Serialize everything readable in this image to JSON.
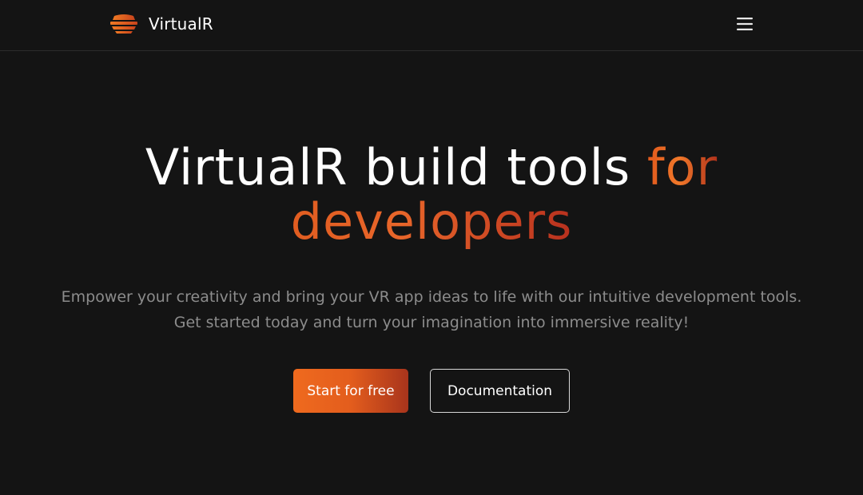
{
  "header": {
    "brand_name": "VirtualR",
    "logo_icon": "virtualr-logo-icon",
    "menu_icon": "hamburger-menu-icon"
  },
  "hero": {
    "title_main": "VirtualR build tools",
    "title_accent": "for",
    "title_line2": "developers",
    "subtitle_line1": "Empower your creativity and bring your VR app ideas to life with our intuitive development tools.",
    "subtitle_line2": "Get started today and turn your imagination into immersive reality!"
  },
  "actions": {
    "primary_label": "Start for free",
    "secondary_label": "Documentation"
  },
  "colors": {
    "background": "#141414",
    "accent_orange": "#ef6a1e",
    "accent_red": "#a8341c",
    "subtitle_gray": "#8c8c8c",
    "border": "#2c2c2c"
  }
}
